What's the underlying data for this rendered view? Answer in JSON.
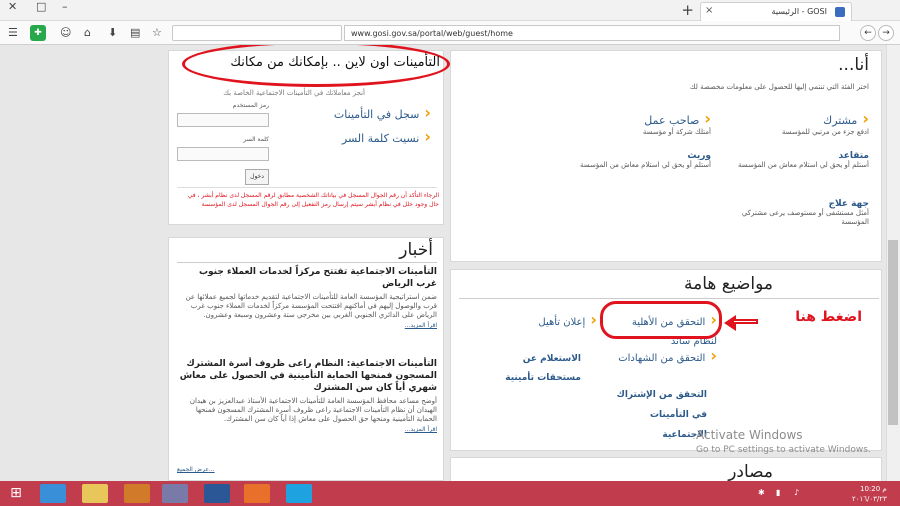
{
  "browser": {
    "tab_title": "GOSI - الرئيسية",
    "tab_close": "×",
    "new_tab": "+",
    "minimize": "–",
    "maximize": "□",
    "close": "✕",
    "url": "www.gosi.gov.sa/portal/web/guest/home",
    "icons": {
      "menu": "hamburger-icon",
      "chat": "chat-icon",
      "home": "home-icon",
      "downloads": "download-icon",
      "bookmarks": "clipboard-icon",
      "star": "star-icon",
      "back": "arrow-left-icon",
      "forward": "arrow-right-icon"
    }
  },
  "login": {
    "annotation": "التأمينات اون لاين .. بإمكانك من مكانك",
    "lead": "أنجز معاملاتك في التأمينات الاجتماعية الخاصة بك",
    "register": "سجل في التأمينات",
    "forgot": "نسيت كلمة السر",
    "username_label": "رمز المستخدم",
    "password_label": "كلمة السر",
    "login_button": "دخول",
    "warning": "الرجاء التأكد أن رقم الجوال المسجل في بياناتك الشخصية مطابق لرقم المسجل لدى نظام أبشر ، في حال وجود خلل في نظام أبشر سيتم إرسال رمز التفعيل إلى رقم الجوال المسجل لدى المؤسسة"
  },
  "iam": {
    "title": "أنا...",
    "subtitle": "اختر الفئة التي تنتمي إليها للحصول على معلومات مخصصة لك",
    "items": [
      {
        "title": "مشترك",
        "desc": "ادفع جزء من مرتبي للمؤسسة"
      },
      {
        "title": "صاحب عمل",
        "desc": "أمتلك شركة أو مؤسسة"
      },
      {
        "title": "متقاعد",
        "desc": "أستلم أو يحق لي استلام معاش من المؤسسة"
      },
      {
        "title": "وريث",
        "desc": "أستلم أو يحق لي استلام معاش من المؤسسة"
      },
      {
        "title": "جهة علاج",
        "desc": "أمثل مستشفى أو مستوصف يرعى مشتركي المؤسسة"
      }
    ]
  },
  "news": {
    "title": "أخبار",
    "items": [
      {
        "title": "التأمينات الاجتماعية تفتتح مركزاً لخدمات العملاء جنوب غرب الرياض",
        "body": "ضمن استراتيجية المؤسسة العامة للتأمينات الاجتماعية لتقديم خدماتها لجميع عملائها عن قرب والوصول إليهم في أماكنهم افتتحت المؤسسة مركزاً لخدمات العملاء جنوب غرب الرياض على الدائري الجنوبي الغربي بين مخرجي ستة وعشرون وسبعة وعشرون.",
        "more": "اقرأ المزيد..."
      },
      {
        "title": "التأمينات الاجتماعية: النظام راعى ظروف أسرة المشترك المسجون فمنحها الحماية التأمينية في الحصول على معاش شهري أياً كان سن المشترك",
        "body": "أوضح مساعد محافظ المؤسسة العامة للتأمينات الاجتماعية الأستاذ عبدالعزيز بن هيدان الهيدان أن نظام التأمينات الاجتماعية راعى ظروف أسرة المشترك المسجون فمنحها الحماية التأمينية ومنحها حق الحصول على معاش إذا أياً كان سن المشترك.",
        "more": "اقرأ المزيد..."
      }
    ],
    "all": "عرض الجميع..."
  },
  "topics": {
    "title": "مواضيع هامة",
    "items": [
      {
        "title": "التحقق من الأهلية لنظام ساند"
      },
      {
        "title": "إعلان تأهيل"
      },
      {
        "title": "التحقق من الشهادات"
      },
      {
        "title": "الاستعلام عن مستحقات تأمينية"
      },
      {
        "title": "التحقق من الإشتراك في التأمينات الاجتماعية"
      }
    ],
    "annotation": "اضغط هنا"
  },
  "sources": {
    "title": "مصادر"
  },
  "watermark": {
    "line1": "Activate Windows",
    "line2": "Go to PC settings to activate Windows."
  },
  "taskbar": {
    "time": "10:20 م",
    "date": "٢٠١٦/٠٣/٢٣"
  },
  "colors": {
    "annotation_red": "#e0141e",
    "link_blue": "#2c5a8a",
    "arrow_orange": "#f0a000",
    "taskbar": "#c13c4d"
  }
}
